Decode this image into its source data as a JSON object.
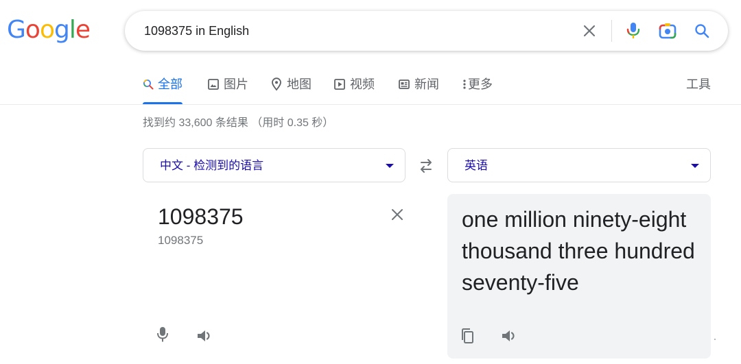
{
  "logo": {
    "letters": [
      {
        "ch": "G",
        "color": "#4285F4"
      },
      {
        "ch": "o",
        "color": "#EA4335"
      },
      {
        "ch": "o",
        "color": "#FBBC05"
      },
      {
        "ch": "g",
        "color": "#4285F4"
      },
      {
        "ch": "l",
        "color": "#34A853"
      },
      {
        "ch": "e",
        "color": "#EA4335"
      }
    ]
  },
  "search": {
    "value": "1098375 in English",
    "icons": {
      "clear": "close-icon",
      "voice": "microphone-icon",
      "lens": "camera-icon",
      "submit": "search-icon"
    }
  },
  "tabs": [
    {
      "label": "全部",
      "icon": "search-icon",
      "active": true
    },
    {
      "label": "图片",
      "icon": "image-icon"
    },
    {
      "label": "地图",
      "icon": "map-pin-icon"
    },
    {
      "label": "视频",
      "icon": "play-icon"
    },
    {
      "label": "新闻",
      "icon": "news-icon"
    },
    {
      "label": "更多",
      "icon": "more-vertical-icon"
    }
  ],
  "tools_label": "工具",
  "result_stats": "找到约 33,600 条结果 （用时 0.35 秒）",
  "translator": {
    "source_lang": "中文 - 检测到的语言",
    "target_lang": "英语",
    "source_text": "1098375",
    "source_transliteration": "1098375",
    "target_text": "one million ninety-eight thousand three hundred seventy-five"
  },
  "colors": {
    "accent": "#1a73e8",
    "link": "#1a0dab",
    "panel": "#f1f3f4"
  }
}
